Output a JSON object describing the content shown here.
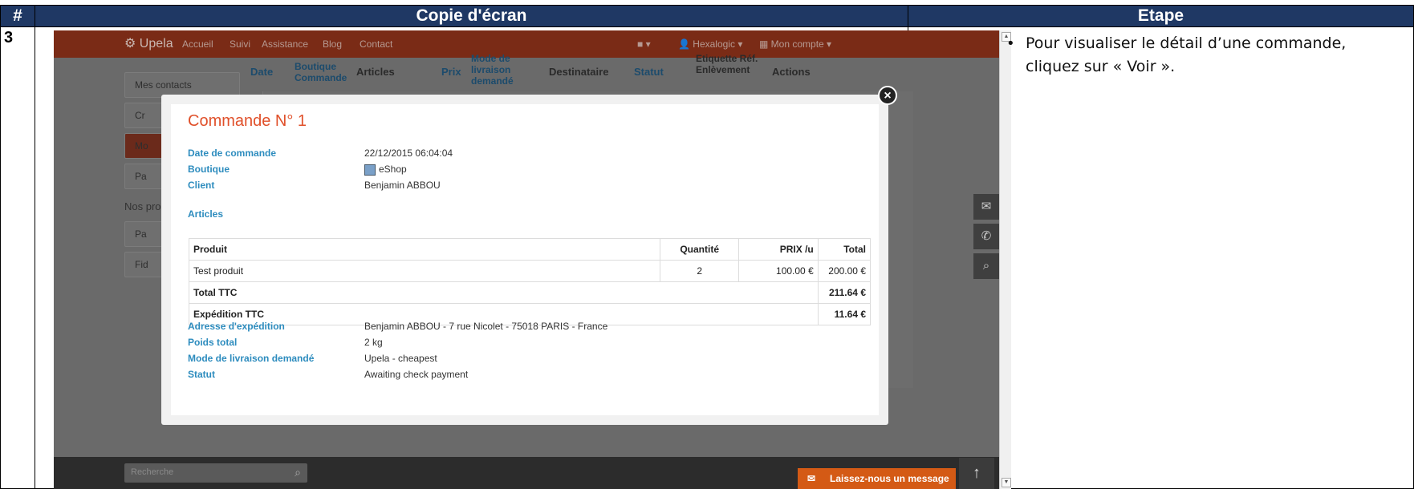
{
  "table": {
    "col_num": "#",
    "col_screenshot": "Copie d'écran",
    "col_step": "Etape",
    "row_num": "3",
    "step_text": "Pour visualiser le détail d’une commande, cliquez sur « Voir »."
  },
  "app": {
    "brand": "Upela",
    "nav": [
      "Accueil",
      "Suivi",
      "Assistance",
      "Blog",
      "Contact"
    ],
    "user": "Hexalogic",
    "account": "Mon compte",
    "sidebar": [
      "Mes contacts",
      "Cr",
      "Mo",
      "Pa"
    ],
    "sidebar_section": "Nos pro",
    "sidebar2": [
      "Pa",
      "Fid"
    ],
    "list_headers": [
      "Date",
      "Boutique Commande",
      "Articles",
      "Prix",
      "Mode de livraison demandé",
      "Destinataire",
      "Statut",
      "Etiquette Réf. Enlèvement",
      "Actions"
    ],
    "search_placeholder": "Recherche",
    "message_button": "Laissez-nous un message"
  },
  "modal": {
    "title": "Commande N° 1",
    "order_date_label": "Date de commande",
    "order_date": "22/12/2015 06:04:04",
    "shop_label": "Boutique",
    "shop": "eShop",
    "client_label": "Client",
    "client": "Benjamin ABBOU",
    "articles_label": "Articles",
    "columns": {
      "product": "Produit",
      "qty": "Quantité",
      "unit_price": "PRIX /u",
      "total": "Total"
    },
    "items": [
      {
        "product": "Test produit",
        "qty": "2",
        "unit_price": "100.00 €",
        "total": "200.00 €"
      }
    ],
    "total_label": "Total TTC",
    "total": "211.64 €",
    "shipping_label": "Expédition TTC",
    "shipping": "11.64 €",
    "address_label": "Adresse d'expédition",
    "address": "Benjamin ABBOU - 7 rue Nicolet - 75018 PARIS - France",
    "weight_label": "Poids total",
    "weight": "2 kg",
    "mode_label": "Mode de livraison demandé",
    "mode": "Upela - cheapest",
    "status_label": "Statut",
    "status": "Awaiting check payment"
  },
  "colors": {
    "header_bg": "#1f3864",
    "title_accent": "#e0502a",
    "label_blue": "#2d8cbe",
    "navbar": "#7a2b16"
  }
}
